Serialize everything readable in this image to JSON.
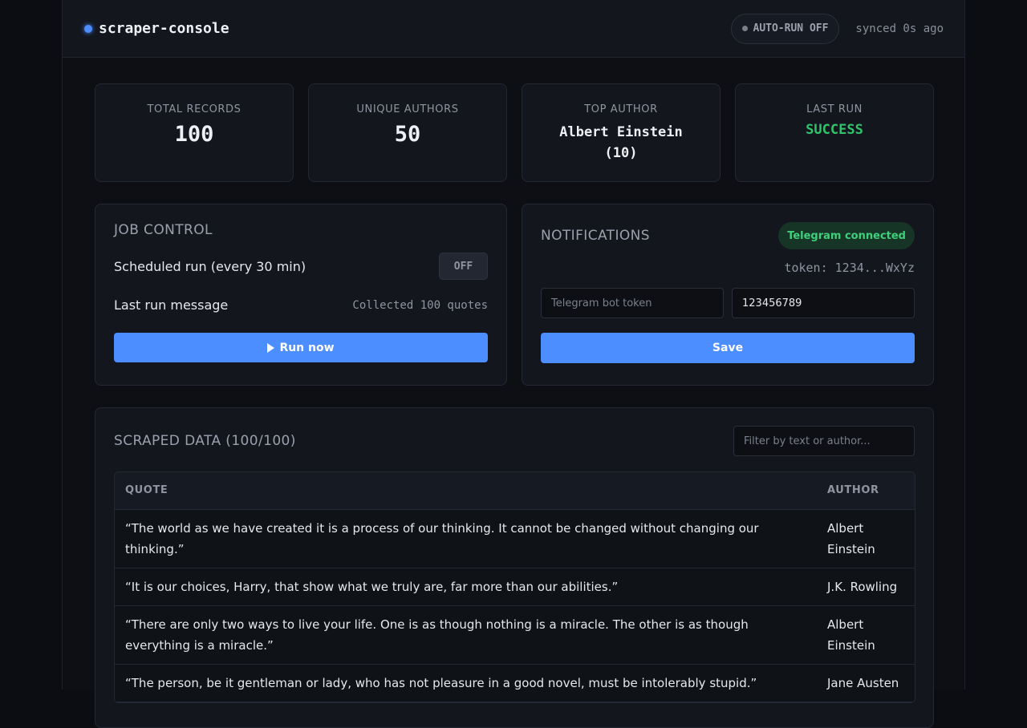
{
  "header": {
    "title": "scraper-console",
    "autorun_label": "AUTO-RUN OFF",
    "synced": "synced 0s ago"
  },
  "stats": [
    {
      "label": "TOTAL RECORDS",
      "value": "100"
    },
    {
      "label": "UNIQUE AUTHORS",
      "value": "50"
    },
    {
      "label": "TOP AUTHOR",
      "value_line1": "Albert Einstein",
      "value_line2": "(10)"
    },
    {
      "label": "LAST RUN",
      "value": "SUCCESS"
    }
  ],
  "job": {
    "title": "JOB CONTROL",
    "scheduled_label": "Scheduled run (every 30 min)",
    "toggle_state": "OFF",
    "last_message_label": "Last run message",
    "last_message_value": "Collected 100 quotes",
    "run_button": "Run now"
  },
  "notifications": {
    "title": "NOTIFICATIONS",
    "status_badge": "Telegram connected",
    "token_display": "token: 1234...WxYz",
    "token_placeholder": "Telegram bot token",
    "chat_id_value": "123456789",
    "save_button": "Save"
  },
  "data": {
    "title": "SCRAPED DATA (100/100)",
    "filter_placeholder": "Filter by text or author...",
    "columns": [
      "QUOTE",
      "AUTHOR"
    ],
    "rows": [
      {
        "quote": "“The world as we have created it is a process of our thinking. It cannot be changed without changing our thinking.”",
        "author": "Albert Einstein"
      },
      {
        "quote": "“It is our choices, Harry, that show what we truly are, far more than our abilities.”",
        "author": "J.K. Rowling"
      },
      {
        "quote": "“There are only two ways to live your life. One is as though nothing is a miracle. The other is as though everything is a miracle.”",
        "author": "Albert Einstein"
      },
      {
        "quote": "“The person, be it gentleman or lady, who has not pleasure in a good novel, must be intolerably stupid.”",
        "author": "Jane Austen"
      }
    ]
  },
  "colors": {
    "accent": "#4c8dff",
    "success": "#2fc46a",
    "background": "#0d0f14"
  }
}
